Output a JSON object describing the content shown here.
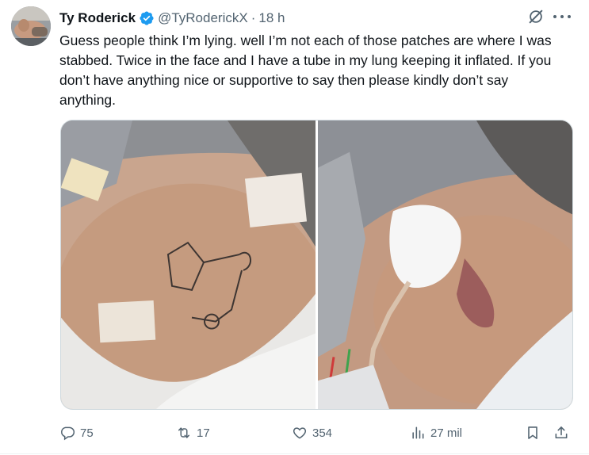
{
  "author": {
    "name": "Ty Roderick",
    "handle": "@TyRoderickX",
    "separator": "·",
    "time": "18 h",
    "verified": true
  },
  "tweet": {
    "text": "Guess people think I’m lying. well I’m not each of those patches are where I was stabbed. Twice in the face and I have a tube in my lung keeping it inflated. If you don’t have anything nice or supportive to say then please kindly don’t say anything."
  },
  "actions": {
    "replies": "75",
    "reposts": "17",
    "likes": "354",
    "views": "27 mil"
  },
  "colors": {
    "text": "#0f1419",
    "secondary": "#536471",
    "verified": "#1d9bf0"
  }
}
